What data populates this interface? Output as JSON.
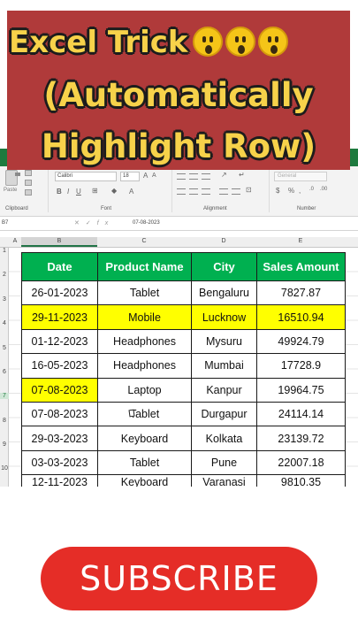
{
  "banner": {
    "line1": "Excel Trick",
    "line2": "(Automatically",
    "line3": "Highlight Row)",
    "emoji_icon": "astonished-face-emoji",
    "colors": {
      "background": "#b03a3a",
      "text": "#f7d24a"
    }
  },
  "ribbon": {
    "paste_label": "Paste",
    "font_name": "Calibri",
    "font_size": "18",
    "number_format": "General",
    "groups": {
      "clipboard": "Clipboard",
      "font": "Font",
      "alignment": "Alignment",
      "number": "Number"
    }
  },
  "formula_bar": {
    "name_box": "B7",
    "value": "07-08-2023"
  },
  "columns": [
    "A",
    "B",
    "C",
    "D",
    "E"
  ],
  "rows": [
    "1",
    "2",
    "3",
    "4",
    "5",
    "6",
    "7",
    "8",
    "9",
    "10"
  ],
  "table": {
    "headers": [
      "Date",
      "Product Name",
      "City",
      "Sales Amount"
    ],
    "data": [
      [
        "26-01-2023",
        "Tablet",
        "Bengaluru",
        "7827.87"
      ],
      [
        "29-11-2023",
        "Mobile",
        "Lucknow",
        "16510.94"
      ],
      [
        "01-12-2023",
        "Headphones",
        "Mysuru",
        "49924.79"
      ],
      [
        "16-05-2023",
        "Headphones",
        "Mumbai",
        "17728.9"
      ],
      [
        "07-08-2023",
        "Laptop",
        "Kanpur",
        "19964.75"
      ],
      [
        "07-08-2023",
        "Tablet",
        "Durgapur",
        "24114.14"
      ],
      [
        "29-03-2023",
        "Keyboard",
        "Kolkata",
        "23139.72"
      ],
      [
        "03-03-2023",
        "Tablet",
        "Pune",
        "22007.18"
      ],
      [
        "12-11-2023",
        "Keyboard",
        "Varanasi",
        "9810.35"
      ]
    ],
    "colors": {
      "header": "#00b050",
      "highlight": "#ffff00"
    }
  },
  "subscribe": {
    "label": "SUBSCRIBE",
    "color": "#e52d27"
  }
}
